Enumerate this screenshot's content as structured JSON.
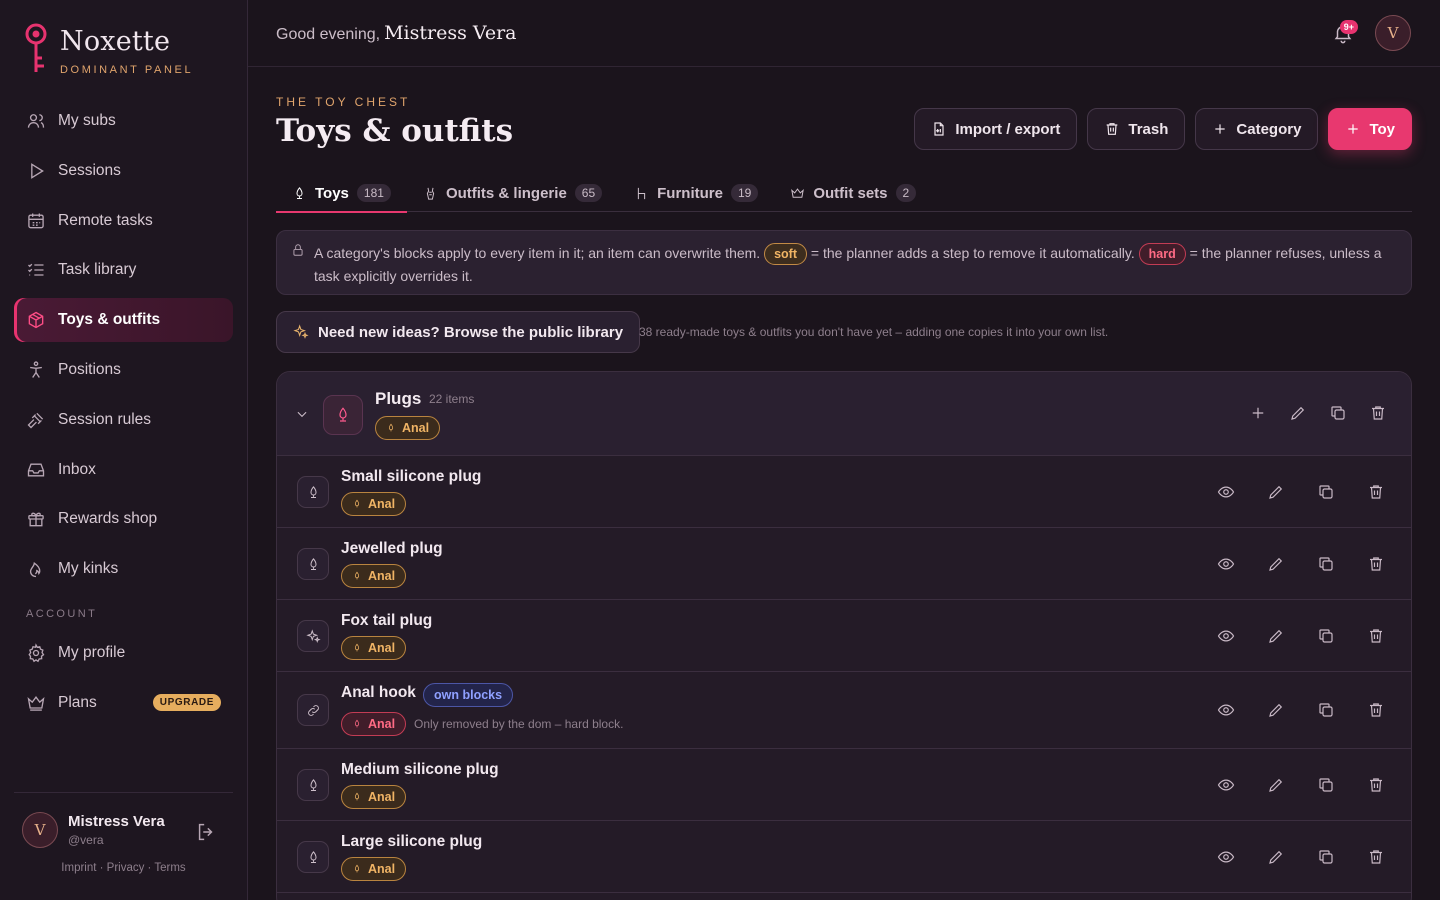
{
  "brand": {
    "name": "Noxette",
    "subtitle": "DOMINANT PANEL"
  },
  "colors": {
    "accent": "#e8386f",
    "gold": "#e0a46c",
    "soft": "#f0b465",
    "hard": "#ff6b85",
    "background": "#1b141c"
  },
  "sidebar": {
    "items": [
      {
        "label": "My subs",
        "icon": "users-icon"
      },
      {
        "label": "Sessions",
        "icon": "play-icon"
      },
      {
        "label": "Remote tasks",
        "icon": "calendar-icon"
      },
      {
        "label": "Task library",
        "icon": "checklist-icon"
      },
      {
        "label": "Toys & outfits",
        "icon": "box-icon",
        "active": true
      },
      {
        "label": "Positions",
        "icon": "figure-icon"
      },
      {
        "label": "Session rules",
        "icon": "gavel-icon"
      },
      {
        "label": "Inbox",
        "icon": "inbox-icon"
      },
      {
        "label": "Rewards shop",
        "icon": "gift-icon"
      },
      {
        "label": "My kinks",
        "icon": "flame-icon"
      }
    ],
    "account_label": "ACCOUNT",
    "account_items": [
      {
        "label": "My profile",
        "icon": "gear-icon"
      },
      {
        "label": "Plans",
        "icon": "crown-icon",
        "badge": "UPGRADE"
      }
    ],
    "user": {
      "initial": "V",
      "name": "Mistress Vera",
      "handle": "@vera"
    },
    "footer_links": "Imprint · Privacy · Terms"
  },
  "header": {
    "greeting": "Good evening,",
    "name": "Mistress Vera",
    "notif_badge": "9+",
    "avatar_initial": "V"
  },
  "page": {
    "eyebrow": "THE TOY CHEST",
    "title": "Toys & outfits",
    "actions": {
      "import": "Import / export",
      "trash": "Trash",
      "category": "Category",
      "toy": "Toy"
    },
    "tabs": [
      {
        "label": "Toys",
        "count": "181",
        "icon": "plug-icon",
        "active": true
      },
      {
        "label": "Outfits & lingerie",
        "count": "65",
        "icon": "corset-icon"
      },
      {
        "label": "Furniture",
        "count": "19",
        "icon": "chair-icon"
      },
      {
        "label": "Outfit sets",
        "count": "2",
        "icon": "crown-icon"
      }
    ],
    "info": {
      "part1": "A category's blocks apply to every item in it; an item can overwrite them.",
      "soft": "soft",
      "part2": "= the planner adds a step to remove it automatically.",
      "hard": "hard",
      "part3": "= the planner refuses, unless a task explicitly overrides it."
    },
    "browse": {
      "label": "Need new ideas? Browse the public library",
      "note": "38 ready-made toys & outfits you don't have yet – adding one copies it into your own list."
    }
  },
  "group": {
    "title": "Plugs",
    "count": "22 items",
    "tag": "Anal",
    "items": [
      {
        "name": "Small silicone plug",
        "tag": "Anal",
        "icon": "plug-icon"
      },
      {
        "name": "Jewelled plug",
        "tag": "Anal",
        "icon": "plug-icon"
      },
      {
        "name": "Fox tail plug",
        "tag": "Anal",
        "icon": "sparkle-icon"
      },
      {
        "name": "Anal hook",
        "tag": "Anal",
        "icon": "link-icon",
        "badge": "own blocks",
        "note": "Only removed by the dom – hard block.",
        "hard": true
      },
      {
        "name": "Medium silicone plug",
        "tag": "Anal",
        "icon": "plug-icon"
      },
      {
        "name": "Large silicone plug",
        "tag": "Anal",
        "icon": "plug-icon"
      }
    ]
  }
}
